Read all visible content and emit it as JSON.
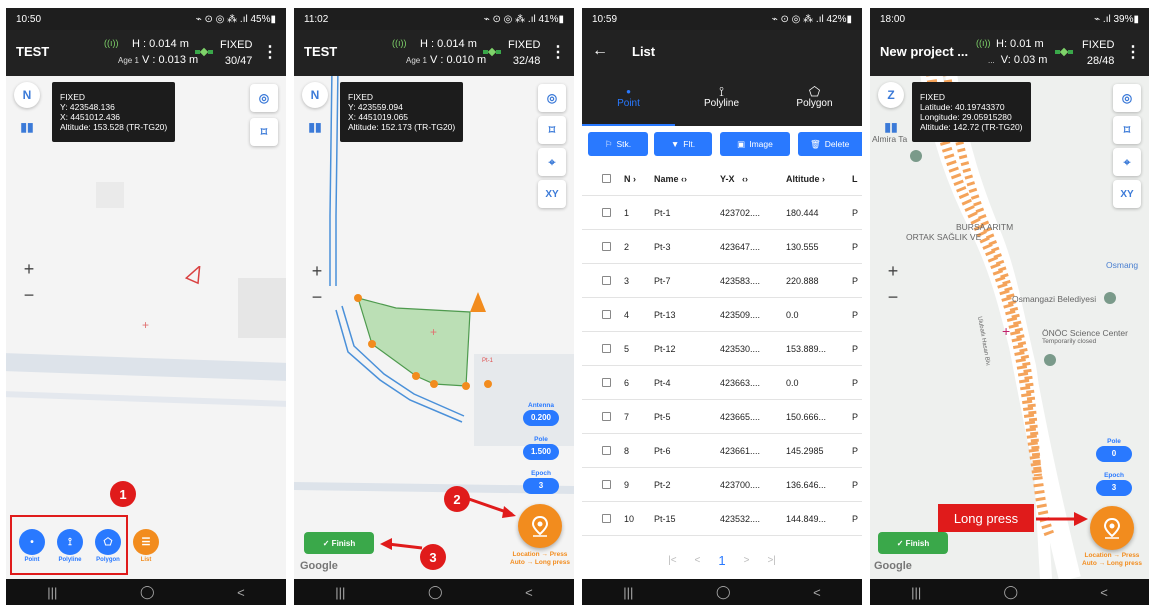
{
  "screens": [
    {
      "status": {
        "time": "10:50",
        "right": "⌁ ⊙ ◎ ⁂ .ıl 45%▮"
      },
      "app_title": "TEST",
      "gps": {
        "h": "H : 0.014 m",
        "age": "Age 1",
        "v": "V : 0.013 m"
      },
      "fix": {
        "state": "FIXED",
        "sats": "30/47"
      },
      "info": {
        "l1": "FIXED",
        "l2": "Y: 423548.136",
        "l3": "X: 4451012.436",
        "l4": "Altitude: 153.528 (TR-TG20)"
      },
      "tools": [
        {
          "label": "Point",
          "icon": "•"
        },
        {
          "label": "Polyline",
          "icon": "⟟"
        },
        {
          "label": "Polygon",
          "icon": "⬠"
        }
      ],
      "list_label": "List",
      "badge": "1"
    },
    {
      "status": {
        "time": "11:02",
        "right": "⌁ ⊙ ◎ ⁂ .ıl 41%▮"
      },
      "app_title": "TEST",
      "gps": {
        "h": "H : 0.014 m",
        "age": "Age 1",
        "v": "V : 0.010 m"
      },
      "fix": {
        "state": "FIXED",
        "sats": "32/48"
      },
      "info": {
        "l1": "FIXED",
        "l2": "Y: 423559.094",
        "l3": "X: 4451019.065",
        "l4": "Altitude: 152.173 (TR-TG20)"
      },
      "point_label": "Pt-1",
      "chips": [
        {
          "label": "Antenna",
          "value": "0.200"
        },
        {
          "label": "Pole",
          "value": "1.500"
        },
        {
          "label": "Epoch",
          "value": "3"
        }
      ],
      "loc_hint1": "Location → Press",
      "loc_hint2": "Auto → Long press",
      "finish": "✓ Finish",
      "google": "Google",
      "badge2": "2",
      "badge3": "3",
      "xy": "XY"
    },
    {
      "status": {
        "time": "10:59",
        "right": "⌁ ⊙ ◎ ⁂ .ıl 42%▮"
      },
      "title": "List",
      "tabs": [
        {
          "label": "Point",
          "icon": "•"
        },
        {
          "label": "Polyline",
          "icon": "⟟"
        },
        {
          "label": "Polygon",
          "icon": "⬠"
        }
      ],
      "toolbar": [
        {
          "label": "Stk.",
          "icon": "⚐"
        },
        {
          "label": "Flt.",
          "icon": "▼"
        },
        {
          "label": "Image",
          "icon": "▣"
        },
        {
          "label": "Delete",
          "icon": "🗑"
        }
      ],
      "headers": {
        "no": "N",
        "name": "Name",
        "yx": "Y-X",
        "alt": "Altitude",
        "last": "L"
      },
      "rows": [
        {
          "no": "1",
          "name": "Pt-1",
          "yx": "423702....",
          "alt": "180.444",
          "last": "P"
        },
        {
          "no": "2",
          "name": "Pt-3",
          "yx": "423647....",
          "alt": "130.555",
          "last": "P"
        },
        {
          "no": "3",
          "name": "Pt-7",
          "yx": "423583....",
          "alt": "220.888",
          "last": "P"
        },
        {
          "no": "4",
          "name": "Pt-13",
          "yx": "423509....",
          "alt": "0.0",
          "last": "P"
        },
        {
          "no": "5",
          "name": "Pt-12",
          "yx": "423530....",
          "alt": "153.889...",
          "last": "P"
        },
        {
          "no": "6",
          "name": "Pt-4",
          "yx": "423663....",
          "alt": "0.0",
          "last": "P"
        },
        {
          "no": "7",
          "name": "Pt-5",
          "yx": "423665....",
          "alt": "150.666...",
          "last": "P"
        },
        {
          "no": "8",
          "name": "Pt-6",
          "yx": "423661....",
          "alt": "145.2985",
          "last": "P"
        },
        {
          "no": "9",
          "name": "Pt-2",
          "yx": "423700....",
          "alt": "136.646...",
          "last": "P"
        },
        {
          "no": "10",
          "name": "Pt-15",
          "yx": "423532....",
          "alt": "144.849...",
          "last": "P"
        }
      ],
      "pager": {
        "first": "|<",
        "prev": "<",
        "current": "1",
        "next": ">",
        "last": ">|"
      }
    },
    {
      "status": {
        "time": "18:00",
        "right": "⌁ .ıl 39%▮"
      },
      "app_title": "New project ...",
      "gps": {
        "h": "H: 0.01 m",
        "age": "...",
        "v": "V: 0.03 m"
      },
      "fix": {
        "state": "FIXED",
        "sats": "28/48"
      },
      "info": {
        "l1": "FIXED",
        "l2": "Latitude: 40.19743370",
        "l3": "Longitude: 29.05915280",
        "l4": "Altitude: 142.72 (TR-TG20)"
      },
      "map_labels": {
        "almira": "Almira Ta",
        "bursa1": "BURSA ARITM",
        "bursa2": "ORTAK SAĞLIK VE",
        "osmang": "Osmang",
        "belediye": "Osmangazi Belediyesi",
        "onoc": "ÖNÖC Science Center",
        "onoc2": "Temporarily closed",
        "street": "Ulubatlı Hasan Blv."
      },
      "chips": [
        {
          "label": "Pole",
          "value": "0"
        },
        {
          "label": "Epoch",
          "value": "3"
        }
      ],
      "long_press": "Long press",
      "loc_hint1": "Location → Press",
      "loc_hint2": "Auto → Long press",
      "finish": "✓ Finish",
      "google": "Google",
      "xy": "XY"
    }
  ],
  "nav": {
    "recent": "|||",
    "home": "◯",
    "back": "<"
  },
  "colors": {
    "accent": "#2979ff",
    "orange": "#f28c1e",
    "finish": "#3aa84a",
    "badge": "#e01b1b"
  }
}
